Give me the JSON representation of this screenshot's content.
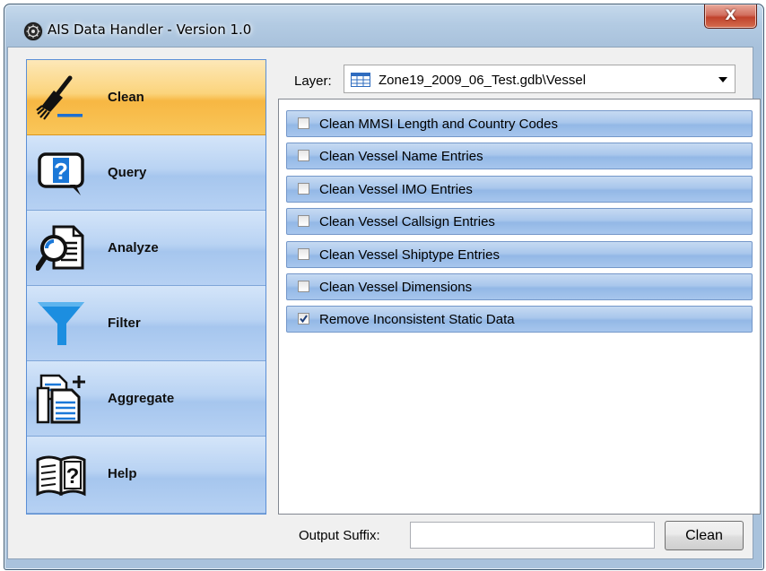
{
  "window": {
    "title": "AIS Data Handler - Version 1.0",
    "close_label": "X"
  },
  "sidebar": {
    "items": [
      {
        "label": "Clean",
        "icon": "broom-icon",
        "active": true
      },
      {
        "label": "Query",
        "icon": "question-bubble-icon",
        "active": false
      },
      {
        "label": "Analyze",
        "icon": "magnifier-document-icon",
        "active": false
      },
      {
        "label": "Filter",
        "icon": "funnel-icon",
        "active": false
      },
      {
        "label": "Aggregate",
        "icon": "add-documents-icon",
        "active": false
      },
      {
        "label": "Help",
        "icon": "help-book-icon",
        "active": false
      }
    ]
  },
  "layer": {
    "label": "Layer:",
    "value": "Zone19_2009_06_Test.gdb\\Vessel",
    "icon": "table-icon"
  },
  "options": [
    {
      "label": "Clean MMSI Length and Country Codes",
      "checked": false
    },
    {
      "label": "Clean Vessel Name Entries",
      "checked": false
    },
    {
      "label": "Clean Vessel IMO Entries",
      "checked": false
    },
    {
      "label": "Clean Vessel Callsign Entries",
      "checked": false
    },
    {
      "label": "Clean Vessel Shiptype Entries",
      "checked": false
    },
    {
      "label": "Clean Vessel Dimensions",
      "checked": false
    },
    {
      "label": "Remove Inconsistent Static Data",
      "checked": true
    }
  ],
  "output": {
    "suffix_label": "Output Suffix:",
    "suffix_value": "",
    "button_label": "Clean"
  },
  "colors": {
    "active_nav": "#f7b743",
    "nav": "#a6c6ee",
    "option_row": "#93b8e6"
  }
}
